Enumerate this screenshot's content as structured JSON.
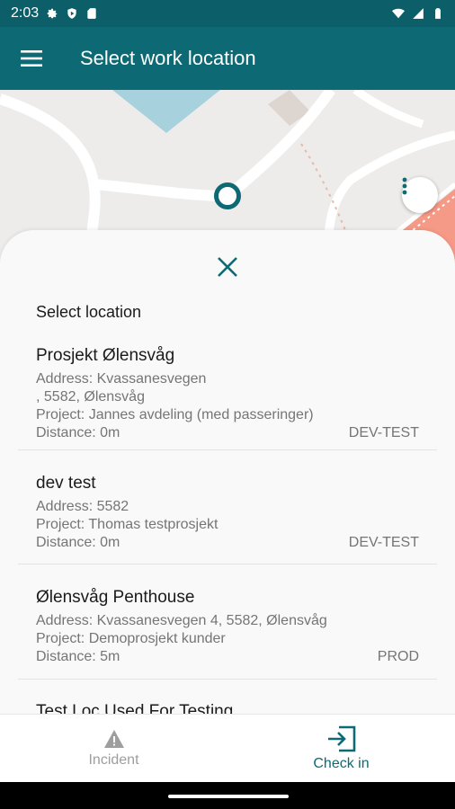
{
  "status_bar": {
    "time": "2:03",
    "left_icons": [
      "gear-icon",
      "shield-play-icon",
      "sd-card-icon"
    ],
    "right_icons": [
      "wifi-icon",
      "signal-icon",
      "battery-icon"
    ]
  },
  "app_bar": {
    "title": "Select work location",
    "menu_icon": "menu-icon"
  },
  "colors": {
    "primary": "#0d6a74",
    "status_bar": "#0c5f69",
    "map_background": "#eeecea",
    "map_water": "#a8d1de",
    "map_road_highlight": "#f59a86"
  },
  "sheet": {
    "title": "Select location",
    "locations": [
      {
        "name": "Prosjekt Ølensvåg",
        "address": "Address: Kvassanesvegen",
        "address_cont": ", 5582, Ølensvåg",
        "project": "Project:  Jannes avdeling (med passeringer)",
        "distance": "Distance: 0m",
        "env": "DEV-TEST"
      },
      {
        "name": "dev test",
        "address": "Address: 5582",
        "project": "Project:  Thomas testprosjekt",
        "distance": "Distance: 0m",
        "env": "DEV-TEST"
      },
      {
        "name": "Ølensvåg Penthouse",
        "address": "Address: Kvassanesvegen 4, 5582, Ølensvåg",
        "project": "Project:  Demoprosjekt kunder",
        "distance": "Distance: 5m",
        "env": "PROD"
      },
      {
        "name": "Test Loc Used For Testing"
      }
    ]
  },
  "bottom_nav": {
    "incident_label": "Incident",
    "checkin_label": "Check in"
  }
}
